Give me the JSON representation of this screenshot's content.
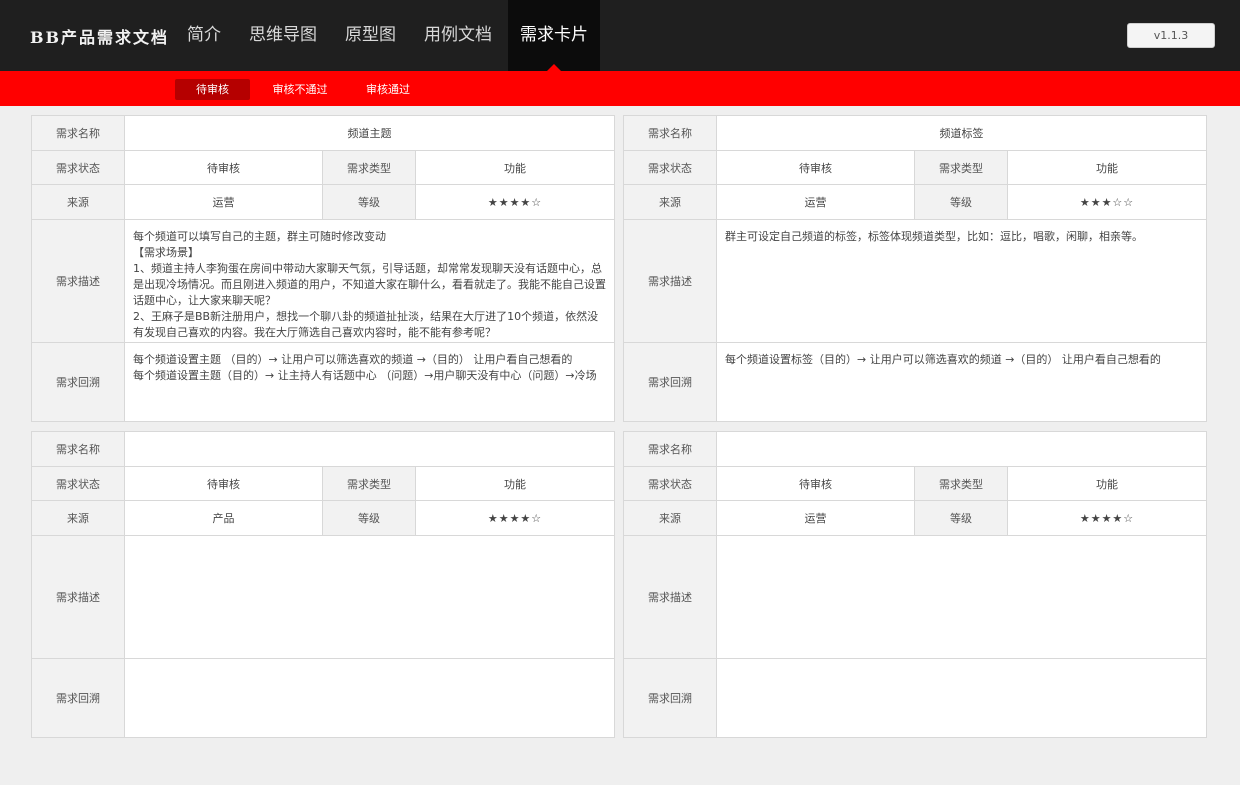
{
  "header": {
    "logo": "BB产品需求文档",
    "nav": [
      "简介",
      "思维导图",
      "原型图",
      "用例文档",
      "需求卡片"
    ],
    "active_nav": 4,
    "version": "v1.1.3"
  },
  "subnav": {
    "tabs": [
      "待审核",
      "审核不通过",
      "审核通过"
    ],
    "active": 0
  },
  "labels": {
    "name": "需求名称",
    "status": "需求状态",
    "type": "需求类型",
    "source": "来源",
    "level": "等级",
    "description": "需求描述",
    "trace": "需求回溯"
  },
  "cards": [
    {
      "name": "频道主题",
      "status": "待审核",
      "type": "功能",
      "source": "运营",
      "level": "★★★★☆",
      "description": [
        "每个频道可以填写自己的主题，群主可随时修改变动",
        "【需求场景】",
        "1、频道主持人李狗蛋在房间中带动大家聊天气氛，引导话题，却常常发现聊天没有话题中心，总是出现冷场情况。而且刚进入频道的用户，不知道大家在聊什么，看看就走了。我能不能自己设置话题中心，让大家来聊天呢？",
        "2、王麻子是BB新注册用户，想找一个聊八卦的频道扯扯淡，结果在大厅进了10个频道，依然没有发现自己喜欢的内容。我在大厅筛选自己喜欢内容时，能不能有参考呢？"
      ],
      "trace": [
        "每个频道设置主题 （目的）→ 让用户可以筛选喜欢的频道 →（目的） 让用户看自己想看的",
        "每个频道设置主题（目的）→ 让主持人有话题中心 （问题）→用户聊天没有中心（问题）→冷场"
      ]
    },
    {
      "name": "频道标签",
      "status": "待审核",
      "type": "功能",
      "source": "运营",
      "level": "★★★☆☆",
      "description": [
        "群主可设定自己频道的标签，标签体现频道类型，比如：逗比，唱歌，闲聊，相亲等。"
      ],
      "trace": [
        "每个频道设置标签（目的）→ 让用户可以筛选喜欢的频道 →（目的） 让用户看自己想看的"
      ]
    },
    {
      "name": "",
      "status": "待审核",
      "type": "功能",
      "source": "产品",
      "level": "★★★★☆",
      "description": [],
      "trace": []
    },
    {
      "name": "",
      "status": "待审核",
      "type": "功能",
      "source": "运营",
      "level": "★★★★☆",
      "description": [],
      "trace": []
    }
  ]
}
